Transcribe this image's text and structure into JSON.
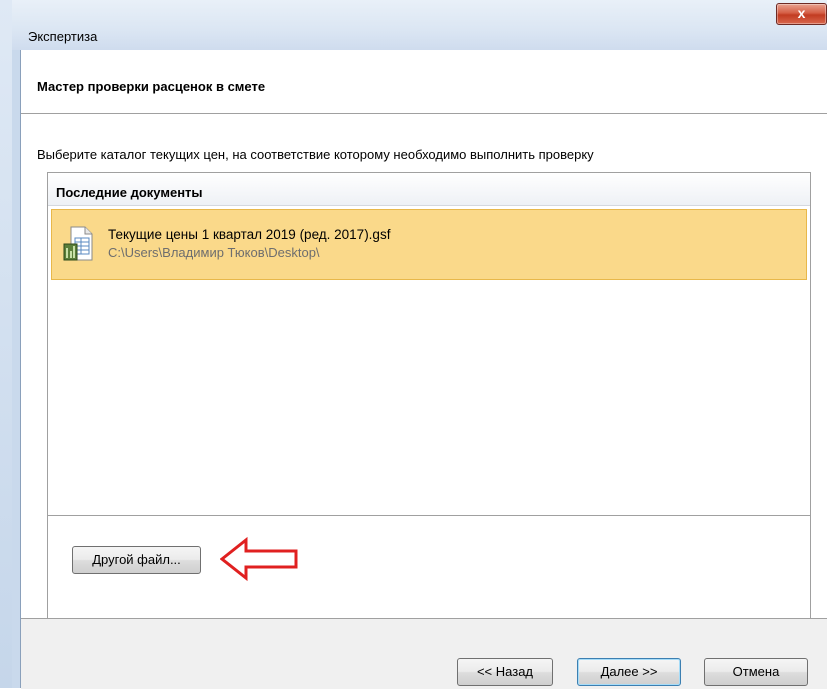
{
  "window": {
    "title": "Экспертиза",
    "close_label": "x"
  },
  "wizard": {
    "title": "Мастер проверки расценок в смете",
    "instruction": "Выберите каталог текущих цен, на соответствие которому необходимо выполнить проверку"
  },
  "recent": {
    "header": "Последние документы",
    "items": [
      {
        "name": "Текущие цены 1 квартал 2019 (ред. 2017).gsf",
        "path": "C:\\Users\\Владимир Тюков\\Desktop\\",
        "icon": "spreadsheet-file-icon",
        "selected": true
      }
    ]
  },
  "buttons": {
    "other_file": "Другой файл...",
    "back": "<< Назад",
    "next": "Далее >>",
    "cancel": "Отмена"
  },
  "colors": {
    "selection": "#fad98a",
    "annotation_arrow": "#e02020"
  }
}
